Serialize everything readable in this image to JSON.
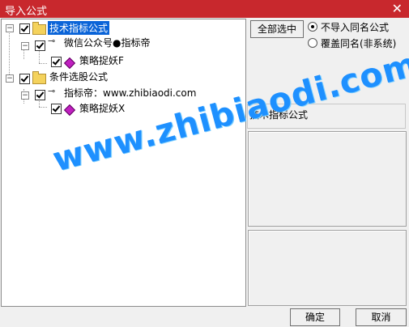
{
  "window": {
    "title": "导入公式",
    "close_glyph": "✕"
  },
  "tree": {
    "root1": {
      "label": "技术指标公式",
      "expander": "−"
    },
    "r1_child": {
      "label": "微信公众号●指标帝",
      "expander": "−"
    },
    "r1_leaf": {
      "label": "策略捉妖F"
    },
    "root2": {
      "label": "条件选股公式",
      "expander": "−"
    },
    "r2_child": {
      "label": "指标帝：www.zhibiaodi.com",
      "expander": "−"
    },
    "r2_leaf": {
      "label": "策略捉妖X"
    }
  },
  "options": {
    "select_all_label": "全部选中",
    "radio_no_import": "不导入同名公式",
    "radio_overwrite": "覆盖同名(非系统)"
  },
  "description": {
    "text": "技术指标公式"
  },
  "buttons": {
    "ok": "确定",
    "cancel": "取消"
  },
  "watermark": {
    "text": "www.zhibiaodi.com"
  },
  "colors": {
    "titlebar": "#c8282d",
    "selection": "#0a64d8",
    "watermark": "#1e90ff"
  }
}
